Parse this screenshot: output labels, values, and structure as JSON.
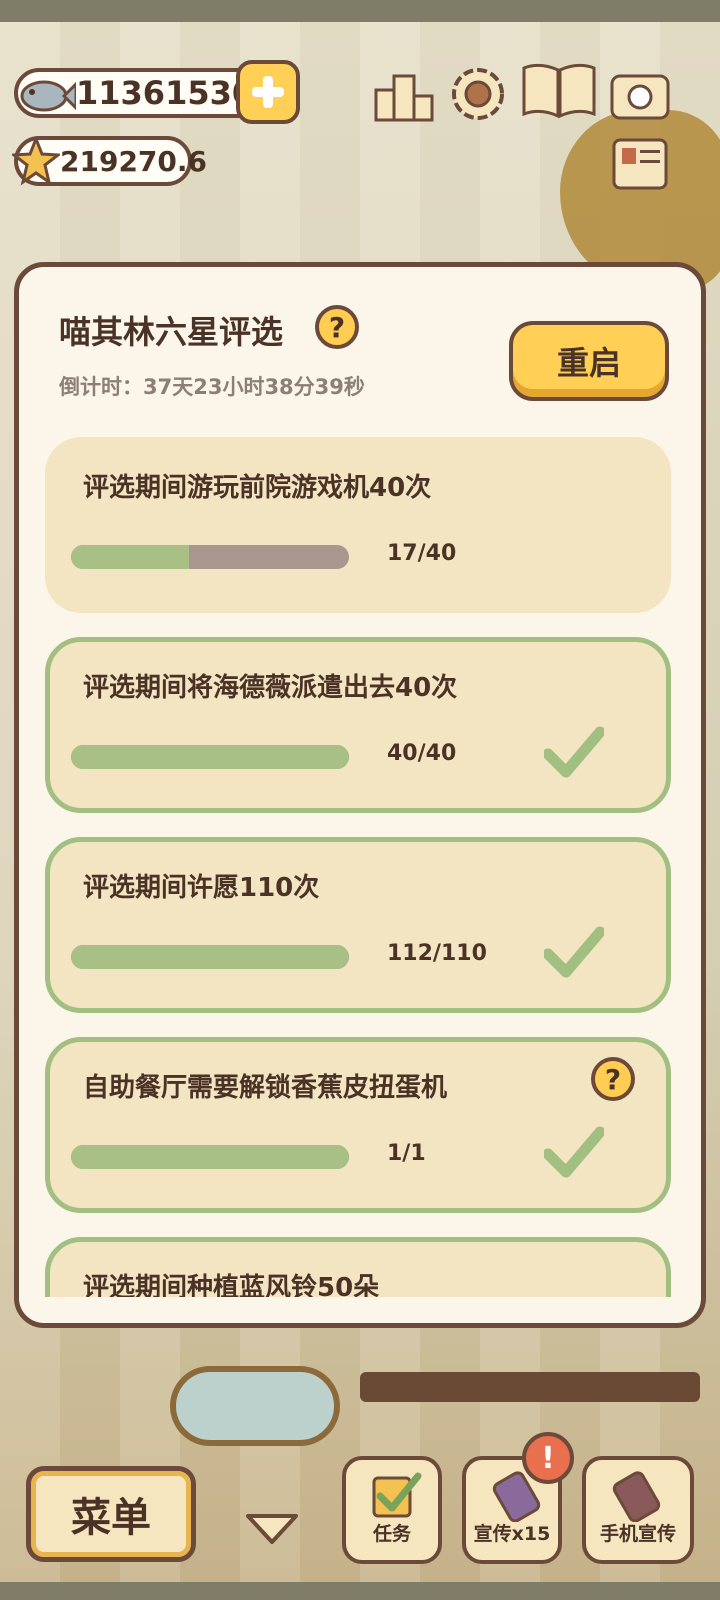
{
  "currency": {
    "fish": "11361530",
    "stars": "219270.6"
  },
  "modal": {
    "title": "喵其林六星评选",
    "countdown": "倒计时：37天23小时38分39秒",
    "restart_label": "重启"
  },
  "tasks": [
    {
      "text": "评选期间游玩前院游戏机40次",
      "progress": "17/40",
      "fraction": 0.425,
      "completed": false
    },
    {
      "text": "评选期间将海德薇派遣出去40次",
      "progress": "40/40",
      "fraction": 1.0,
      "completed": true
    },
    {
      "text": "评选期间许愿110次",
      "progress": "112/110",
      "fraction": 1.0,
      "completed": true
    },
    {
      "text": "自助餐厅需要解锁香蕉皮扭蛋机",
      "progress": "1/1",
      "fraction": 1.0,
      "completed": true,
      "has_help": true
    },
    {
      "text": "评选期间种植蓝风铃50朵",
      "completed": true
    }
  ],
  "bottom": {
    "menu_label": "菜单",
    "tasks_label": "任务",
    "promo_label": "宣传x15",
    "phone_promo_label": "手机宣传",
    "alert_symbol": "!"
  },
  "colors": {
    "accent_yellow": "#ffd055",
    "border_brown": "#6b4a3a",
    "progress_green": "#a8bf85",
    "task_bg": "#f3e4c2"
  },
  "icons": {
    "help": "?"
  }
}
